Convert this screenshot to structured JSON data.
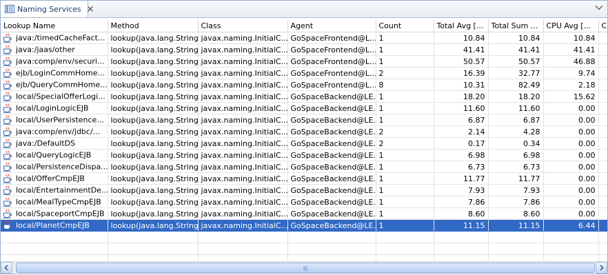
{
  "view": {
    "tab_title": "Naming Services"
  },
  "colors": {
    "selection": "#3169c6",
    "tab_text": "#1d3a6b",
    "frame_border": "#9ab0cc"
  },
  "icons": {
    "tab": "naming-services-view-icon",
    "row": "java-cup-icon",
    "close": "close-icon",
    "menu": "view-menu-chevron-icon"
  },
  "table": {
    "columns": [
      "Lookup Name",
      "Method",
      "Class",
      "Agent",
      "Count",
      "Total Avg [...",
      "Total Sum ...",
      "CPU Avg [...",
      "C"
    ],
    "rows": [
      {
        "lookup": "java:/timedCacheFact...",
        "method": "lookup(java.lang.String)",
        "class": "javax.naming.InitialC...",
        "agent": "GoSpaceFrontend@L...",
        "count": "1",
        "total_avg": "10.84",
        "total_sum": "10.84",
        "cpu_avg": "10.84",
        "c": "",
        "selected": false
      },
      {
        "lookup": "java:/jaas/other",
        "method": "lookup(java.lang.String)",
        "class": "javax.naming.InitialC...",
        "agent": "GoSpaceFrontend@L...",
        "count": "1",
        "total_avg": "41.41",
        "total_sum": "41.41",
        "cpu_avg": "41.41",
        "c": "",
        "selected": false
      },
      {
        "lookup": "java:comp/env/securi...",
        "method": "lookup(java.lang.String)",
        "class": "javax.naming.InitialC...",
        "agent": "GoSpaceFrontend@L...",
        "count": "1",
        "total_avg": "50.57",
        "total_sum": "50.57",
        "cpu_avg": "46.88",
        "c": "",
        "selected": false
      },
      {
        "lookup": "ejb/LoginCommHome...",
        "method": "lookup(java.lang.String)",
        "class": "javax.naming.InitialC...",
        "agent": "GoSpaceFrontend@L...",
        "count": "2",
        "total_avg": "16.39",
        "total_sum": "32.77",
        "cpu_avg": "9.74",
        "c": "",
        "selected": false
      },
      {
        "lookup": "ejb/QueryCommHome...",
        "method": "lookup(java.lang.String)",
        "class": "javax.naming.InitialC...",
        "agent": "GoSpaceFrontend@L...",
        "count": "8",
        "total_avg": "10.31",
        "total_sum": "82.49",
        "cpu_avg": "2.18",
        "c": "",
        "selected": false
      },
      {
        "lookup": "local/SpecialOfferLogi...",
        "method": "lookup(java.lang.String)",
        "class": "javax.naming.InitialC...",
        "agent": "GoSpaceBackend@LE...",
        "count": "1",
        "total_avg": "18.20",
        "total_sum": "18.20",
        "cpu_avg": "15.62",
        "c": "",
        "selected": false
      },
      {
        "lookup": "local/LoginLogicEJB",
        "method": "lookup(java.lang.String)",
        "class": "javax.naming.InitialC...",
        "agent": "GoSpaceBackend@LE...",
        "count": "1",
        "total_avg": "11.60",
        "total_sum": "11.60",
        "cpu_avg": "0.00",
        "c": "",
        "selected": false
      },
      {
        "lookup": "local/UserPersistence...",
        "method": "lookup(java.lang.String)",
        "class": "javax.naming.InitialC...",
        "agent": "GoSpaceBackend@LE...",
        "count": "1",
        "total_avg": "6.87",
        "total_sum": "6.87",
        "cpu_avg": "0.00",
        "c": "",
        "selected": false
      },
      {
        "lookup": "java:comp/env/jdbc/...",
        "method": "lookup(java.lang.String)",
        "class": "javax.naming.InitialC...",
        "agent": "GoSpaceBackend@LE...",
        "count": "2",
        "total_avg": "2.14",
        "total_sum": "4.28",
        "cpu_avg": "0.00",
        "c": "",
        "selected": false
      },
      {
        "lookup": "java:/DefaultDS",
        "method": "lookup(java.lang.String)",
        "class": "javax.naming.InitialC...",
        "agent": "GoSpaceBackend@LE...",
        "count": "2",
        "total_avg": "0.17",
        "total_sum": "0.34",
        "cpu_avg": "0.00",
        "c": "",
        "selected": false
      },
      {
        "lookup": "local/QueryLogicEJB",
        "method": "lookup(java.lang.String)",
        "class": "javax.naming.InitialC...",
        "agent": "GoSpaceBackend@LE...",
        "count": "1",
        "total_avg": "6.98",
        "total_sum": "6.98",
        "cpu_avg": "0.00",
        "c": "",
        "selected": false
      },
      {
        "lookup": "local/PersistenceDispa...",
        "method": "lookup(java.lang.String)",
        "class": "javax.naming.InitialC...",
        "agent": "GoSpaceBackend@LE...",
        "count": "1",
        "total_avg": "6.73",
        "total_sum": "6.73",
        "cpu_avg": "0.00",
        "c": "",
        "selected": false
      },
      {
        "lookup": "local/OfferCmpEJB",
        "method": "lookup(java.lang.String)",
        "class": "javax.naming.InitialC...",
        "agent": "GoSpaceBackend@LE...",
        "count": "1",
        "total_avg": "11.77",
        "total_sum": "11.77",
        "cpu_avg": "0.00",
        "c": "",
        "selected": false
      },
      {
        "lookup": "local/EntertainmentDe...",
        "method": "lookup(java.lang.String)",
        "class": "javax.naming.InitialC...",
        "agent": "GoSpaceBackend@LE...",
        "count": "1",
        "total_avg": "7.93",
        "total_sum": "7.93",
        "cpu_avg": "0.00",
        "c": "",
        "selected": false
      },
      {
        "lookup": "local/MealTypeCmpEJB",
        "method": "lookup(java.lang.String)",
        "class": "javax.naming.InitialC...",
        "agent": "GoSpaceBackend@LE...",
        "count": "1",
        "total_avg": "7.86",
        "total_sum": "7.86",
        "cpu_avg": "0.00",
        "c": "",
        "selected": false
      },
      {
        "lookup": "local/SpaceportCmpEJB",
        "method": "lookup(java.lang.String)",
        "class": "javax.naming.InitialC...",
        "agent": "GoSpaceBackend@LE...",
        "count": "1",
        "total_avg": "8.60",
        "total_sum": "8.60",
        "cpu_avg": "0.00",
        "c": "",
        "selected": false
      },
      {
        "lookup": "local/PlanetCmpEJB",
        "method": "lookup(java.lang.String)",
        "class": "javax.naming.InitialC...",
        "agent": "GoSpaceBackend@LE...",
        "count": "1",
        "total_avg": "11.15",
        "total_sum": "11.15",
        "cpu_avg": "6.44",
        "c": "",
        "selected": true
      }
    ]
  }
}
